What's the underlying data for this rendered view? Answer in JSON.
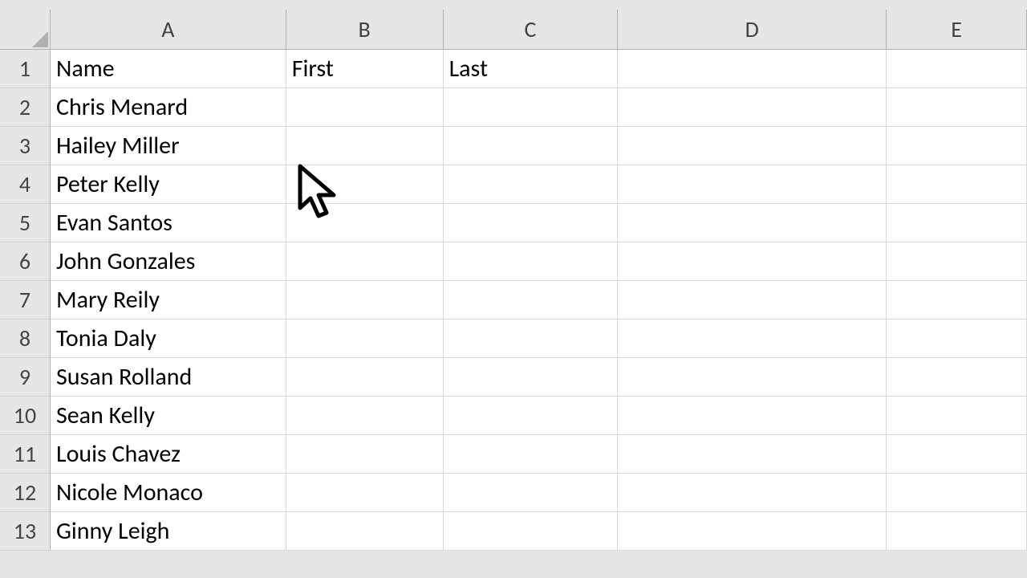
{
  "columns": [
    "A",
    "B",
    "C",
    "D",
    "E"
  ],
  "row_numbers": [
    1,
    2,
    3,
    4,
    5,
    6,
    7,
    8,
    9,
    10,
    11,
    12,
    13
  ],
  "headers": {
    "A": "Name",
    "B": "First",
    "C": "Last",
    "D": "",
    "E": ""
  },
  "rows": [
    {
      "A": "Chris Menard",
      "B": "",
      "C": "",
      "D": "",
      "E": ""
    },
    {
      "A": "Hailey Miller",
      "B": "",
      "C": "",
      "D": "",
      "E": ""
    },
    {
      "A": "Peter Kelly",
      "B": "",
      "C": "",
      "D": "",
      "E": ""
    },
    {
      "A": "Evan Santos",
      "B": "",
      "C": "",
      "D": "",
      "E": ""
    },
    {
      "A": "John Gonzales",
      "B": "",
      "C": "",
      "D": "",
      "E": ""
    },
    {
      "A": "Mary Reily",
      "B": "",
      "C": "",
      "D": "",
      "E": ""
    },
    {
      "A": "Tonia Daly",
      "B": "",
      "C": "",
      "D": "",
      "E": ""
    },
    {
      "A": "Susan Rolland",
      "B": "",
      "C": "",
      "D": "",
      "E": ""
    },
    {
      "A": "Sean Kelly",
      "B": "",
      "C": "",
      "D": "",
      "E": ""
    },
    {
      "A": "Louis Chavez",
      "B": "",
      "C": "",
      "D": "",
      "E": ""
    },
    {
      "A": "Nicole Monaco",
      "B": "",
      "C": "",
      "D": "",
      "E": ""
    },
    {
      "A": "Ginny Leigh",
      "B": "",
      "C": "",
      "D": "",
      "E": ""
    }
  ]
}
